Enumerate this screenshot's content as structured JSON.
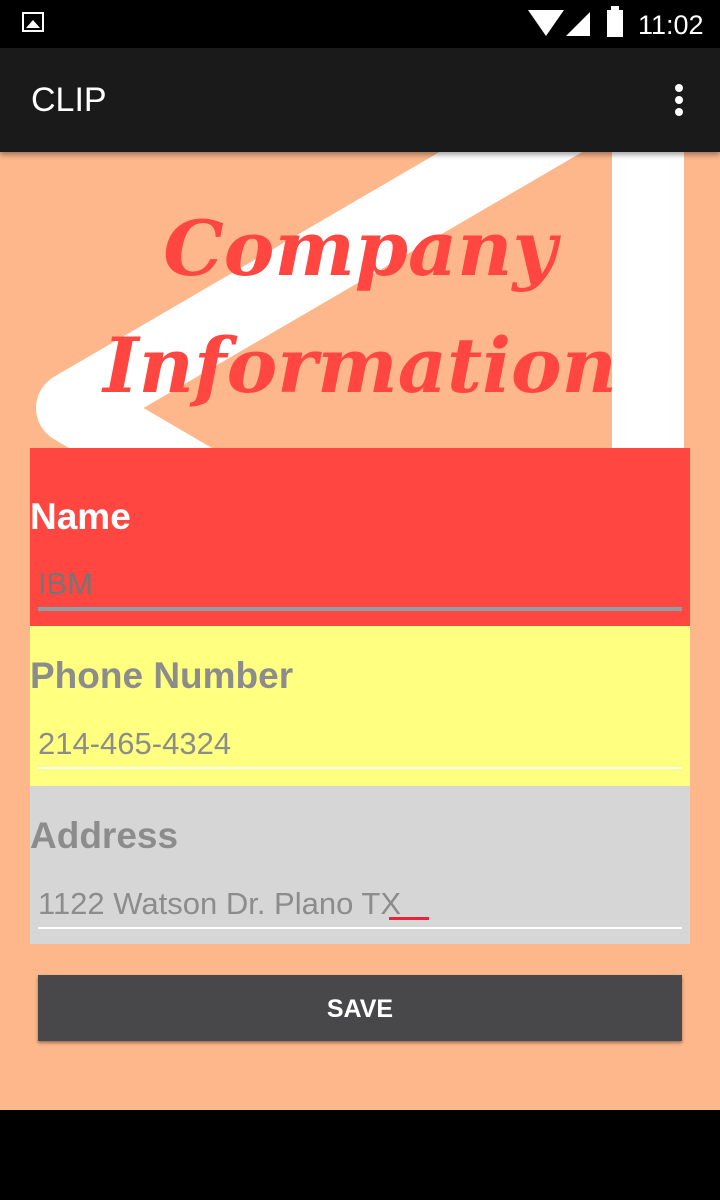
{
  "status_bar": {
    "time": "11:02"
  },
  "app_bar": {
    "title": "CLIP"
  },
  "heading": {
    "line1": "Company",
    "line2": "Information"
  },
  "form": {
    "name": {
      "label": "Name",
      "placeholder": "IBM"
    },
    "phone": {
      "label": "Phone Number",
      "value": "214-465-4324"
    },
    "address": {
      "label": "Address",
      "value": "1122 Watson Dr. Plano TX"
    }
  },
  "save_label": "SAVE",
  "colors": {
    "background": "#FDB78B",
    "accent_red": "#FF4640",
    "phone_bg": "#FFFF80",
    "address_bg": "#D6D6D6",
    "button_bg": "#48484A"
  },
  "icons": [
    "image-notification-icon",
    "wifi-icon",
    "cell-signal-icon",
    "battery-icon",
    "overflow-menu-icon",
    "back-icon",
    "home-icon",
    "recents-icon"
  ]
}
